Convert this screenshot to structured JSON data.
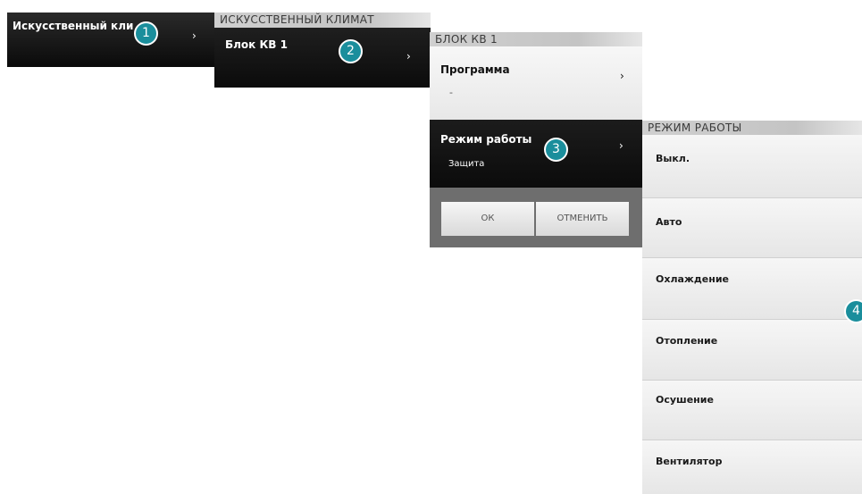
{
  "panel1": {
    "label": "Искусственный кли",
    "chevron": "›",
    "badge": "1"
  },
  "panel2": {
    "header": "ИСКУССТВЕННЫЙ КЛИМАТ",
    "label": "Блок КВ 1",
    "chevron": "›",
    "badge": "2"
  },
  "panel3": {
    "header": "БЛОК КВ 1",
    "program": {
      "label": "Программа",
      "value": "-",
      "chevron": "›"
    },
    "mode": {
      "label": "Режим работы",
      "value": "Защита",
      "chevron": "›",
      "badge": "3"
    },
    "ok_label": "ОК",
    "cancel_label": "ОТМЕНИТЬ"
  },
  "panel4": {
    "header": "РЕЖИМ РАБОТЫ",
    "badge": "4",
    "items": [
      "Выкл.",
      "Авто",
      "Охлаждение",
      "Отопление",
      "Осушение",
      "Вентилятор"
    ]
  },
  "colors": {
    "badge": "#1a8e9c",
    "dark_panel": "#111111",
    "light_panel": "#eeeeee",
    "footer": "#6e6e6e"
  }
}
